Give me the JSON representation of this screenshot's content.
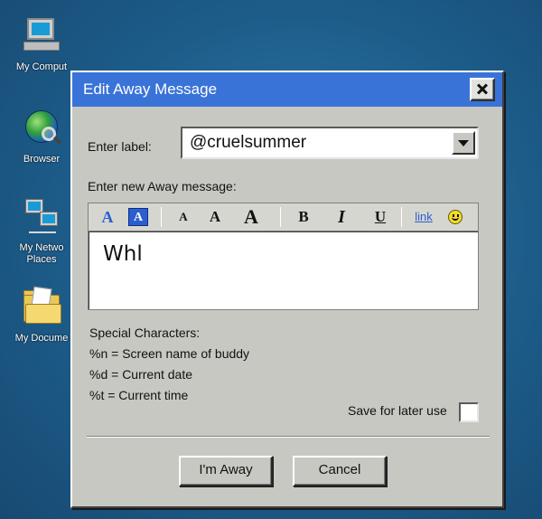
{
  "desktop": {
    "icons": [
      {
        "label": "My Comput",
        "icon": "computer-icon"
      },
      {
        "label": "Browser",
        "icon": "globe-icon"
      },
      {
        "label": "My Netwo Places",
        "icon": "network-icon"
      },
      {
        "label": "My Docume",
        "icon": "folder-icon"
      }
    ]
  },
  "dialog": {
    "title": "Edit Away Message",
    "close_icon": "close-icon",
    "enter_label": "Enter label:",
    "label_value": "@cruelsummer",
    "enter_message": "Enter new Away message:",
    "toolbar": {
      "text_color": "A",
      "bg_color": "A",
      "font_small": "A",
      "font_normal": "A",
      "font_large": "A",
      "bold": "B",
      "italic": "I",
      "underline": "U",
      "link": "link",
      "smiley_icon": "smiley-icon"
    },
    "message_text": "Whl",
    "special": {
      "title": "Special Characters:",
      "n": "%n = Screen name of buddy",
      "d": "%d = Current date",
      "t": "%t = Current time"
    },
    "save_label": "Save for later use",
    "buttons": {
      "away": "I'm Away",
      "cancel": "Cancel"
    }
  },
  "colors": {
    "desktop": "#1f5f8c",
    "title_bar": "#3a73d8",
    "dialog_bg": "#c8c8c2",
    "accent_blue": "#2b5fd0"
  }
}
